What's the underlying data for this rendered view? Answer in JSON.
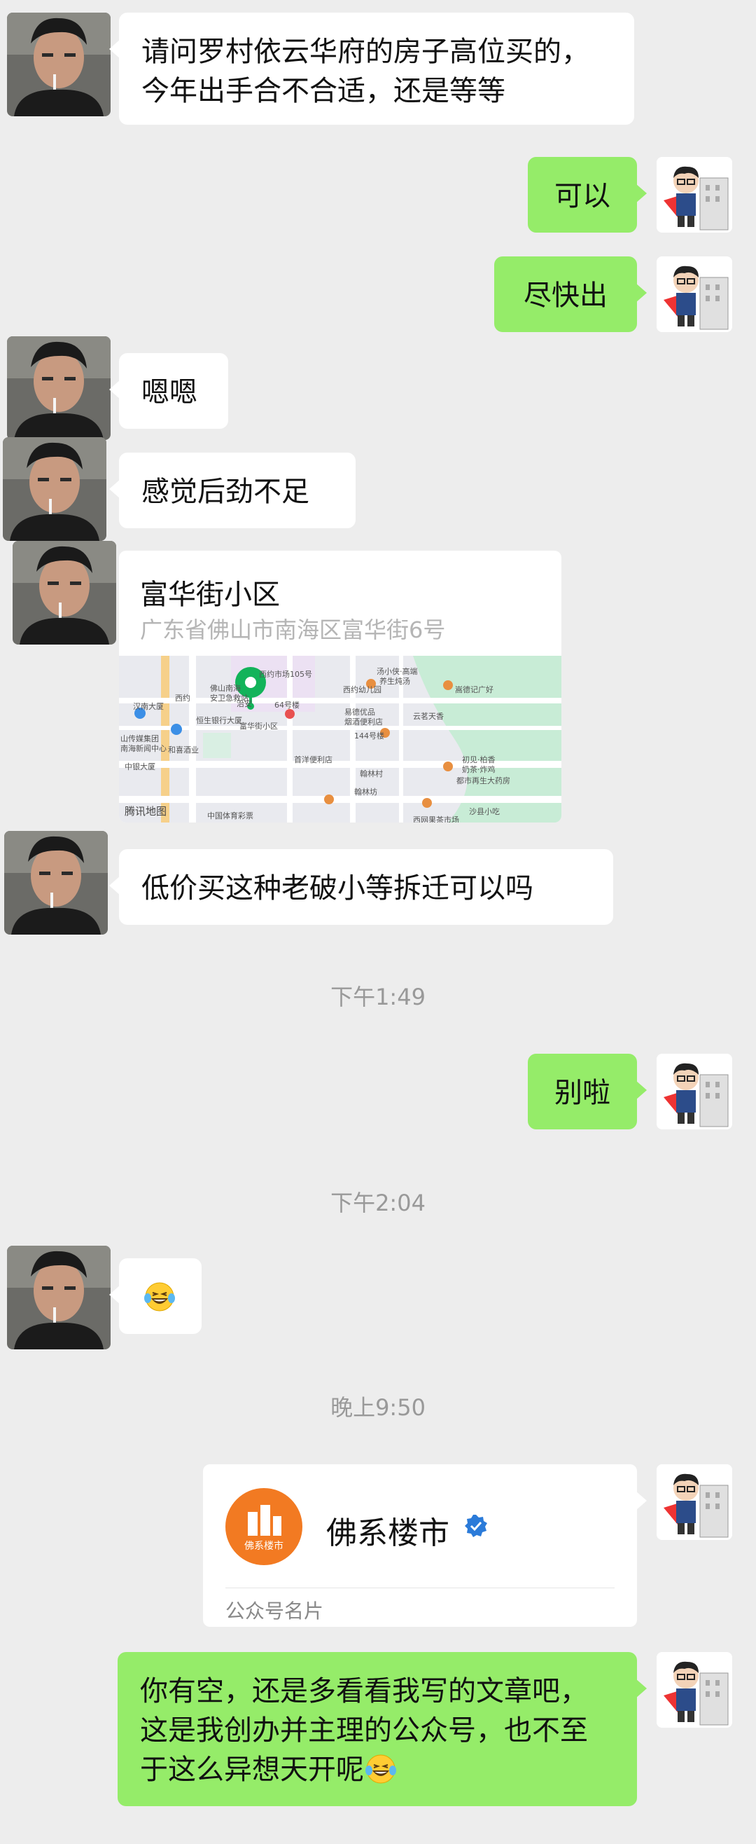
{
  "messages": {
    "m1": "请问罗村依云华府的房子高位买的，今年出手合不合适，还是等等",
    "m2": "可以",
    "m3": "尽快出",
    "m4": "嗯嗯",
    "m5": "感觉后劲不足",
    "m6": "低价买这种老破小等拆迁可以吗",
    "m7": "别啦",
    "m9_prefix": "你有空，还是多看看我写的文章吧，这是我创办并主理的公众号，也不至于这么异想天开呢"
  },
  "location": {
    "name": "富华街小区",
    "address": "广东省佛山市南海区富华街6号",
    "map_brand": "腾讯地图",
    "map_labels": [
      "西约市场105号",
      "汤小侠·高端",
      "养生炖汤",
      "西约幼儿园",
      "64号楼",
      "嵩德记广好",
      "佛山南海",
      "安卫急救站",
      "汉南大厦",
      "西约",
      "恒生银行大厦",
      "易德优品",
      "烟酒便利店",
      "云茗天香",
      "治安",
      "富华街小区",
      "144号楼",
      "山传媒集团",
      "南海新闻中心",
      "和喜酒业",
      "首洋便利店",
      "初见·柏香",
      "奶茶·炸鸡",
      "都市再生大药房",
      "中银大厦",
      "翰林村",
      "翰林坊",
      "中国体育彩票",
      "沙县小吃",
      "西网果茶市场"
    ]
  },
  "timestamps": [
    "下午1:49",
    "下午2:04",
    "晚上9:50"
  ],
  "card": {
    "name": "佛系楼市",
    "logo_text": "佛系楼市",
    "type": "公众号名片"
  },
  "colors": {
    "background": "#ededed",
    "bubble_self": "#95ec69",
    "bubble_other": "#ffffff",
    "card_logo": "#f27a22",
    "verify": "#2b7bd9",
    "map_pin": "#13b35a"
  },
  "icons": {
    "emoji": "laughing-tears-emoji",
    "verified": "verified-badge-icon"
  }
}
